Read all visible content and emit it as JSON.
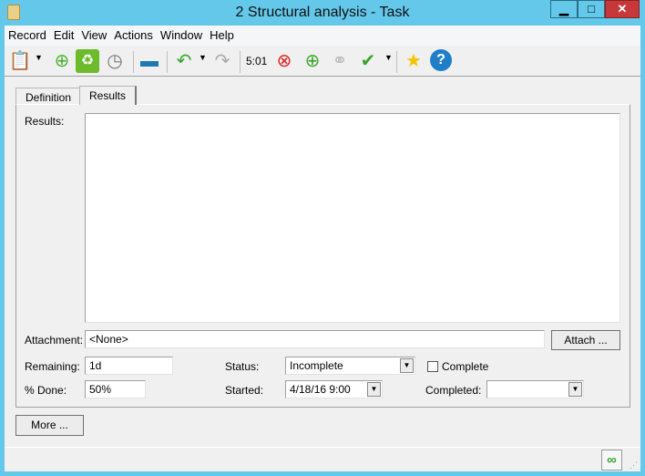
{
  "window": {
    "title": "2 Structural analysis - Task",
    "app_icon": "clipboard-icon",
    "controls": {
      "minimize": "▁",
      "maximize": "□",
      "close": "✕"
    }
  },
  "menu": [
    "Record",
    "Edit",
    "View",
    "Actions",
    "Window",
    "Help"
  ],
  "toolbar": {
    "timer_label": "5:01",
    "icons": [
      "new-task-icon",
      "add-document-icon",
      "recycle-bin-icon",
      "timer-add-icon",
      "print-icon",
      "undo-icon",
      "redo-icon",
      "stop-timer-icon",
      "start-timer-icon",
      "link-icon",
      "check-icon",
      "star-icon",
      "help-icon"
    ]
  },
  "tabs": [
    {
      "label": "Definition",
      "active": false
    },
    {
      "label": "Results",
      "active": true
    }
  ],
  "form": {
    "results_label": "Results:",
    "results_value": "",
    "attachment_label": "Attachment:",
    "attachment_value": "<None>",
    "attach_button": "Attach ...",
    "remaining_label": "Remaining:",
    "remaining_value": "1d",
    "status_label": "Status:",
    "status_value": "Incomplete",
    "complete_label": "Complete",
    "complete_checked": false,
    "done_label": "% Done:",
    "done_value": "50%",
    "started_label": "Started:",
    "started_value": "4/18/16  9:00",
    "completed_label": "Completed:",
    "completed_value": ""
  },
  "more_button": "More ...",
  "colors": {
    "frame": "#64c8ea",
    "close": "#c7383b",
    "accent_green": "#3aa42e"
  }
}
